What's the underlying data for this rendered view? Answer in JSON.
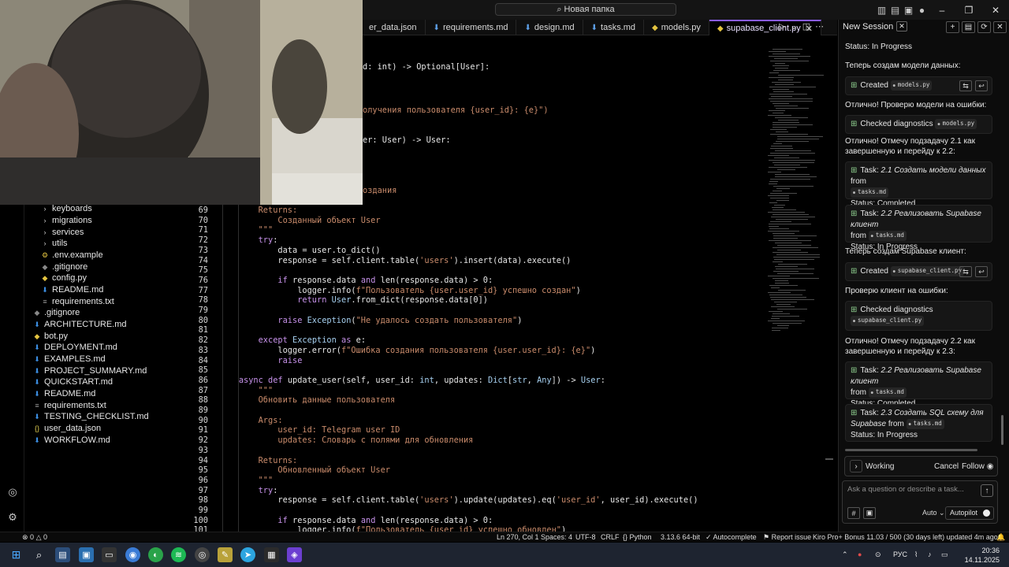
{
  "titlebar": {
    "command_center": "Новая папка"
  },
  "tabs": [
    {
      "label": "er_data.json",
      "icon": "json-icon"
    },
    {
      "label": "requirements.md",
      "icon": "markdown-icon"
    },
    {
      "label": "design.md",
      "icon": "markdown-icon"
    },
    {
      "label": "tasks.md",
      "icon": "markdown-icon"
    },
    {
      "label": "models.py",
      "icon": "python-icon"
    },
    {
      "label": "supabase_client.py",
      "icon": "python-icon",
      "active": true
    }
  ],
  "explorer": {
    "items": [
      {
        "label": "keyboards",
        "kind": "folder",
        "icon": "chevron-right-icon"
      },
      {
        "label": "migrations",
        "kind": "folder",
        "icon": "chevron-right-icon"
      },
      {
        "label": "services",
        "kind": "folder",
        "icon": "chevron-right-icon"
      },
      {
        "label": "utils",
        "kind": "folder",
        "icon": "chevron-right-icon"
      },
      {
        "label": ".env.example",
        "kind": "file",
        "icon": "settings-file-icon"
      },
      {
        "label": ".gitignore",
        "kind": "file",
        "icon": "git-icon"
      },
      {
        "label": "config.py",
        "kind": "file",
        "icon": "python-icon"
      },
      {
        "label": "README.md",
        "kind": "file",
        "icon": "markdown-icon"
      },
      {
        "label": "requirements.txt",
        "kind": "file",
        "icon": "text-file-icon"
      },
      {
        "label": ".gitignore",
        "kind": "file",
        "icon": "git-icon"
      },
      {
        "label": "ARCHITECTURE.md",
        "kind": "file",
        "icon": "markdown-icon"
      },
      {
        "label": "bot.py",
        "kind": "file",
        "icon": "python-icon"
      },
      {
        "label": "DEPLOYMENT.md",
        "kind": "file",
        "icon": "markdown-icon"
      },
      {
        "label": "EXAMPLES.md",
        "kind": "file",
        "icon": "markdown-icon"
      },
      {
        "label": "PROJECT_SUMMARY.md",
        "kind": "file",
        "icon": "markdown-icon"
      },
      {
        "label": "QUICKSTART.md",
        "kind": "file",
        "icon": "markdown-icon"
      },
      {
        "label": "README.md",
        "kind": "file",
        "icon": "markdown-icon"
      },
      {
        "label": "requirements.txt",
        "kind": "file",
        "icon": "text-file-icon"
      },
      {
        "label": "TESTING_CHECKLIST.md",
        "kind": "file",
        "icon": "markdown-icon"
      },
      {
        "label": "user_data.json",
        "kind": "file",
        "icon": "json-icon"
      },
      {
        "label": "WORKFLOW.md",
        "kind": "file",
        "icon": "markdown-icon"
      }
    ]
  },
  "code": {
    "partial_lines": [
      {
        "text": "d: int) -> Optional[User]:"
      },
      {
        "text": "олучения пользователя {user_id}: {e}\")"
      },
      {
        "text": "er: User) -> User:"
      },
      {
        "text": "оздания"
      }
    ],
    "line_numbers": [
      "69",
      "70",
      "71",
      "72",
      "73",
      "74",
      "75",
      "76",
      "77",
      "78",
      "79",
      "80",
      "81",
      "82",
      "83",
      "84",
      "85",
      "86",
      "87",
      "88",
      "89",
      "90",
      "91",
      "92",
      "93",
      "94",
      "95",
      "96",
      "97",
      "98",
      "99",
      "100",
      "101"
    ],
    "lines": [
      "        Returns:",
      "            Созданный объект User",
      "        \"\"\"",
      "        try:",
      "            data = user.to_dict()",
      "            response = self.client.table('users').insert(data).execute()",
      "",
      "            if response.data and len(response.data) > 0:",
      "                logger.info(f\"Пользователь {user.user_id} успешно создан\")",
      "                return User.from_dict(response.data[0])",
      "",
      "            raise Exception(\"Не удалось создать пользователя\")",
      "",
      "        except Exception as e:",
      "            logger.error(f\"Ошибка создания пользователя {user.user_id}: {e}\")",
      "            raise",
      "",
      "    async def update_user(self, user_id: int, updates: Dict[str, Any]) -> User:",
      "        \"\"\"",
      "        Обновить данные пользователя",
      "",
      "        Args:",
      "            user_id: Telegram user ID",
      "            updates: Словарь с полями для обновления",
      "",
      "        Returns:",
      "            Обновленный объект User",
      "        \"\"\"",
      "        try:",
      "            response = self.client.table('users').update(updates).eq('user_id', user_id).execute()",
      "",
      "            if response.data and len(response.data) > 0:",
      "                logger.info(f\"Пользователь {user_id} успешно обновлен\")"
    ]
  },
  "chat": {
    "session_tab": "New Session",
    "top_status": "Status: In Progress",
    "msg_models": "Теперь создам модели данных:",
    "created_label": "Created",
    "created_file_1": "models.py",
    "msg_check_models": "Отлично! Проверю модели на ошибки:",
    "checked_label": "Checked diagnostics",
    "checked_file_1": "models.py",
    "msg_done_21": "Отлично! Отмечу подзадачу 2.1 как завершенную и перейду к 2.2:",
    "task_prefix": "Task:",
    "task_21": "2.1 Создать модели данных",
    "from_label": "from",
    "tasks_file": "tasks.md",
    "status_completed": "Status: Completed",
    "task_22": "2.2 Реализовать Supabase клиент",
    "status_in_progress": "Status: In Progress",
    "msg_create_client": "Теперь создам Supabase клиент:",
    "created_file_2": "supabase_client.py",
    "msg_check_client": "Проверю клиент на ошибки:",
    "checked_file_2": "supabase_client.py",
    "msg_done_22": "Отлично! Отмечу подзадачу 2.2 как завершенную и перейду к 2.3:",
    "task_23": "2.3 Создать SQL схему для Supabase",
    "working_label": "Working",
    "cancel_label": "Cancel",
    "follow_label": "Follow",
    "input_placeholder": "Ask a question or describe a task...",
    "model_select": "Auto",
    "autopilot_label": "Autopilot"
  },
  "statusbar": {
    "problems": "0",
    "warnings": "0",
    "position": "Ln 270, Col 1",
    "spaces": "Spaces: 4",
    "encoding": "UTF-8",
    "eol": "CRLF",
    "language": "Python",
    "interpreter": "3.13.6 64-bit",
    "autocomplete": "Autocomplete",
    "report_issue": "Report issue",
    "plan": "Kiro Pro+ Bonus 11.03 / 500 (30 days left) updated 4m ago"
  },
  "taskbar": {
    "lang": "РУС",
    "time": "20:36",
    "date": "14.11.2025"
  },
  "colors": {
    "accent": "#8a5cf6",
    "keyword": "#c792ea",
    "string": "#c98b6b",
    "taskbar": "#1e2430"
  }
}
